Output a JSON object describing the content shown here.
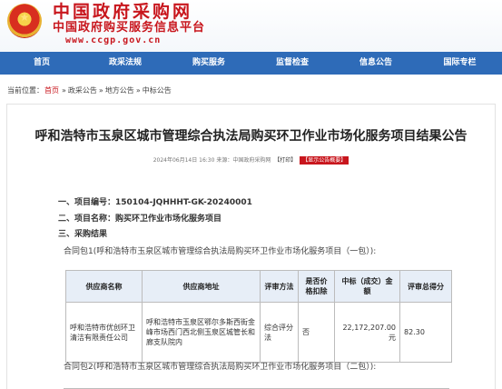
{
  "header": {
    "site_name": "中国政府采购网",
    "subtitle": "中国政府购买服务信息平台",
    "url": "www.ccgp.gov.cn",
    "emblem_star": "★"
  },
  "nav": {
    "items": [
      "首页",
      "政采法规",
      "购买服务",
      "监督检查",
      "信息公告",
      "国际专栏"
    ],
    "color": "#2e6bb8"
  },
  "breadcrumb": {
    "prefix": "当前位置：",
    "home": "首页",
    "items": [
      "政采公告",
      "地方公告",
      "中标公告"
    ],
    "separator": "»"
  },
  "article": {
    "title": "呼和浩特市玉泉区城市管理综合执法局购买环卫作业市场化服务项目结果公告",
    "meta": "2024年06月14日 16:30 来源：中国政府采购网 ",
    "print_label": "【打印】",
    "summary_button": "【显示公告概要】",
    "project_no_label": "一、项目编号：",
    "project_no": "150104-JQHHHT-GK-20240001",
    "project_name_label": "二、项目名称：",
    "project_name": "购买环卫作业市场化服务项目",
    "result_label": "三、采购结果",
    "package1_title": "合同包1(呼和浩特市玉泉区城市管理综合执法局购买环卫作业市场化服务项目（一包）):",
    "package2_title": "合同包2(呼和浩特市玉泉区城市管理综合执法局购买环卫作业市场化服务项目（二包）):"
  },
  "table": {
    "headers": [
      "供应商名称",
      "供应商地址",
      "评审方法",
      "是否价格扣除",
      "中标（成交）金额",
      "评审总得分"
    ],
    "rows": [
      [
        "呼和浩特市优创环卫清洁有限责任公司",
        "呼和浩特市玉泉区鄂尔多斯西街金峰市场西门西北侧玉泉区城管长和廊支队院内",
        "综合评分法",
        "否",
        "22,172,207.00元",
        "82.30"
      ]
    ]
  }
}
